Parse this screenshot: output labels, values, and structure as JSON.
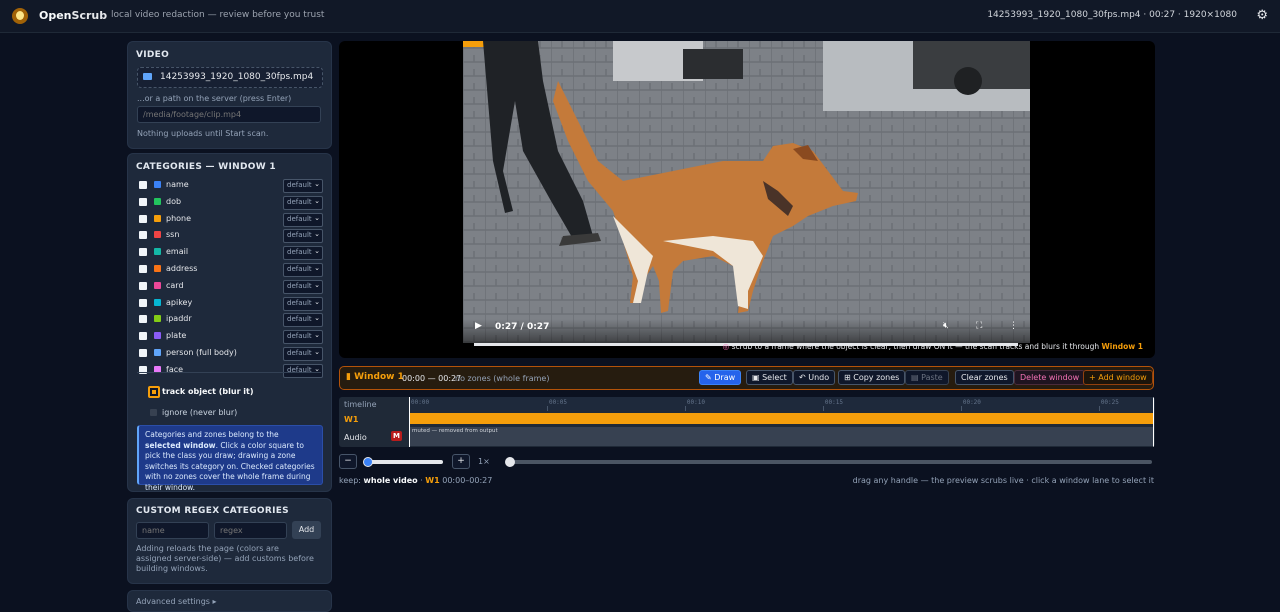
{
  "header": {
    "brand_a": "Open",
    "brand_b": "Scrub",
    "tagline": "local video redaction — review before you trust",
    "file_info": "14253993_1920_1080_30fps.mp4 · 00:27 · 1920×1080",
    "settings_icon": "gear-icon"
  },
  "video_panel": {
    "heading": "VIDEO",
    "selected_file": "14253993_1920_1080_30fps.mp4",
    "path_label": "...or a path on the server (press Enter)",
    "path_placeholder": "/media/footage/clip.mp4",
    "note": "Nothing uploads until Start scan."
  },
  "categories_panel": {
    "heading": "CATEGORIES — WINDOW 1",
    "items": [
      {
        "label": "name",
        "color": "#3b82f6",
        "mode": "default"
      },
      {
        "label": "dob",
        "color": "#22c55e",
        "mode": "default"
      },
      {
        "label": "phone",
        "color": "#f59e0b",
        "mode": "default"
      },
      {
        "label": "ssn",
        "color": "#ef4444",
        "mode": "default"
      },
      {
        "label": "email",
        "color": "#14b8a6",
        "mode": "default"
      },
      {
        "label": "address",
        "color": "#f97316",
        "mode": "default"
      },
      {
        "label": "card",
        "color": "#ec4899",
        "mode": "default"
      },
      {
        "label": "apikey",
        "color": "#06b6d4",
        "mode": "default"
      },
      {
        "label": "ipaddr",
        "color": "#84cc16",
        "mode": "default"
      },
      {
        "label": "plate",
        "color": "#8b5cf6",
        "mode": "default"
      },
      {
        "label": "person (full body)",
        "color": "#60a5fa",
        "mode": "default"
      },
      {
        "label": "face",
        "color": "#e879f9",
        "mode": "default"
      }
    ],
    "track_label": "track object (blur it)",
    "ignore_label": "ignore (never blur)",
    "info_prefix": "Categories and zones belong to the ",
    "info_bold": "selected window",
    "info_suffix": ". Click a color square to pick the class you draw; drawing a zone switches its category on. Checked categories with no zones cover the whole frame during their window."
  },
  "regex_panel": {
    "heading": "CUSTOM REGEX CATEGORIES",
    "name_placeholder": "name",
    "regex_placeholder": "regex",
    "add_label": "Add",
    "note": "Adding reloads the page (colors are assigned server-side) — add customs before building windows."
  },
  "advanced": {
    "label": "Advanced settings ▸"
  },
  "player": {
    "time": "0:27 / 0:27",
    "progress": 1.0,
    "hint_prefix": "scrub to a frame where the object is clear, then draw ON it — the scan tracks and blurs it through ",
    "hint_window": "Window 1"
  },
  "window_bar": {
    "title": "Window 1",
    "range": "00:00 — 00:27",
    "zones": "no zones (whole frame)",
    "buttons": {
      "draw": "✎ Draw",
      "select": "▣ Select",
      "undo": "↶ Undo",
      "copy": "⊞ Copy zones",
      "paste": "▤ Paste",
      "clear": "Clear zones",
      "delete": "Delete window",
      "add": "+ Add window"
    }
  },
  "timeline": {
    "label": "timeline",
    "ticks": [
      "00:00",
      "00:05",
      "00:10",
      "00:15",
      "00:20",
      "00:25"
    ],
    "duration_s": 27,
    "w1_label": "W1",
    "audio_label": "Audio",
    "audio_badge": "M",
    "audio_note": "muted — removed from output"
  },
  "zoom": {
    "minus": "−",
    "plus": "+",
    "rate": "1×",
    "level": 0.0
  },
  "footer": {
    "keep_prefix": "keep:",
    "keep_value": "whole video",
    "keep_window": "W1",
    "keep_range": "00:00–00:27",
    "right_hint": "drag any handle — the preview scrubs live · click a window lane to select it"
  }
}
